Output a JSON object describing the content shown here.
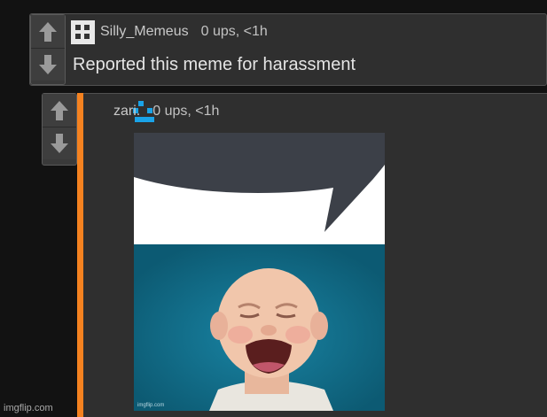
{
  "comments": [
    {
      "username": "Silly_Memeus",
      "ups": "0 ups, <1h",
      "text": "Reported this meme for harassment",
      "avatar": "grid-avatar-icon"
    },
    {
      "username": "zari.",
      "ups": "0 ups, <1h",
      "avatar": "pixel-face-avatar-icon",
      "image": {
        "watermark": "imgflip.com",
        "description_icon": "crying-baby-image"
      }
    }
  ],
  "vote_icons": {
    "up": "arrow-up-icon",
    "down": "arrow-down-icon"
  },
  "colors": {
    "background": "#121212",
    "comment_bg": "#2f2f2f",
    "accent_bar": "#f58220",
    "avatar_blue": "#1aa3e8"
  },
  "site_watermark": "imgflip.com"
}
